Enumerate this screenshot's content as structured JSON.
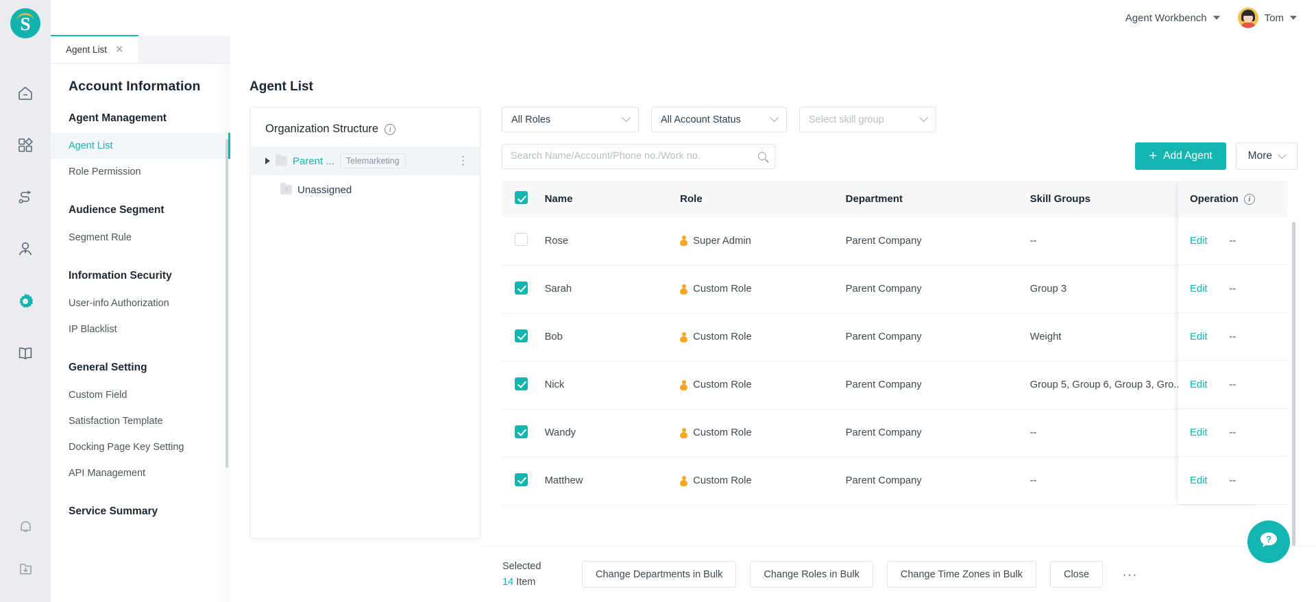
{
  "brand": {
    "logo_letter": "S"
  },
  "topbar": {
    "workspace_label": "Agent Workbench",
    "user_name": "Tom"
  },
  "tabs": [
    {
      "label": "Agent List",
      "close": "✕"
    }
  ],
  "rail": {
    "items": [
      {
        "icon": "home-icon"
      },
      {
        "icon": "apps-icon"
      },
      {
        "icon": "flow-icon"
      },
      {
        "icon": "contact-icon"
      },
      {
        "icon": "gear-icon"
      },
      {
        "icon": "book-icon"
      }
    ],
    "bottom": [
      {
        "icon": "bell-icon"
      },
      {
        "icon": "download-folder-icon"
      }
    ]
  },
  "nav": {
    "title": "Account Information",
    "groups": [
      {
        "label": "Agent Management",
        "items": [
          {
            "label": "Agent List",
            "active": true
          },
          {
            "label": "Role Permission",
            "active": false
          }
        ]
      },
      {
        "label": "Audience Segment",
        "items": [
          {
            "label": "Segment Rule",
            "active": false
          }
        ]
      },
      {
        "label": "Information Security",
        "items": [
          {
            "label": "User-info Authorization",
            "active": false
          },
          {
            "label": "IP Blacklist",
            "active": false
          }
        ]
      },
      {
        "label": "General Setting",
        "items": [
          {
            "label": "Custom Field",
            "active": false
          },
          {
            "label": "Satisfaction Template",
            "active": false
          },
          {
            "label": "Docking Page Key Setting",
            "active": false
          },
          {
            "label": "API Management",
            "active": false
          }
        ]
      },
      {
        "label": "Service Summary",
        "items": []
      }
    ]
  },
  "page": {
    "title": "Agent List"
  },
  "org": {
    "title": "Organization Structure",
    "nodes": [
      {
        "label": "Parent ...",
        "chip": "Telemarketing",
        "selected": true,
        "expandable": true
      },
      {
        "label": "Unassigned",
        "chip": "",
        "selected": false,
        "expandable": false
      }
    ]
  },
  "filters": {
    "role": {
      "value": "All Roles",
      "placeholder": false
    },
    "status": {
      "value": "All Account Status",
      "placeholder": false
    },
    "skill_group": {
      "value": "Select skill group",
      "placeholder": true
    }
  },
  "search": {
    "value": "",
    "placeholder": "Search Name/Account/Phone no./Work no."
  },
  "toolbar": {
    "add_agent_label": "Add Agent",
    "add_agent_plus": "+",
    "more_label": "More"
  },
  "table": {
    "columns": [
      "Name",
      "Role",
      "Department",
      "Skill Groups"
    ],
    "operation_column": "Operation",
    "header_checked": true,
    "rows": [
      {
        "checked": false,
        "name": "Rose",
        "role": "Super Admin",
        "department": "Parent Company",
        "skill_groups": "--",
        "edit": "Edit",
        "more": "--"
      },
      {
        "checked": true,
        "name": "Sarah",
        "role": "Custom Role",
        "department": "Parent Company",
        "skill_groups": "Group 3",
        "edit": "Edit",
        "more": "--"
      },
      {
        "checked": true,
        "name": "Bob",
        "role": "Custom Role",
        "department": "Parent Company",
        "skill_groups": "Weight",
        "edit": "Edit",
        "more": "--"
      },
      {
        "checked": true,
        "name": "Nick",
        "role": "Custom Role",
        "department": "Parent Company",
        "skill_groups": "Group 5, Group 6, Group 3, Gro...",
        "edit": "Edit",
        "more": "--"
      },
      {
        "checked": true,
        "name": "Wandy",
        "role": "Custom Role",
        "department": "Parent Company",
        "skill_groups": "--",
        "edit": "Edit",
        "more": "--"
      },
      {
        "checked": true,
        "name": "Matthew",
        "role": "Custom Role",
        "department": "Parent Company",
        "skill_groups": "--",
        "edit": "Edit",
        "more": "--"
      }
    ]
  },
  "bulk": {
    "selected_label": "Selected",
    "count": "14",
    "item_label": "Item",
    "buttons": [
      "Change Departments in Bulk",
      "Change Roles in Bulk",
      "Change Time Zones in Bulk",
      "Close"
    ],
    "overflow": "···"
  },
  "help": {
    "glyph": "?"
  },
  "colors": {
    "accent": "#13b5b1",
    "role_icon": "#f5a623",
    "logo_arc": "#f0b429",
    "rail_bg": "#eaecf0"
  }
}
